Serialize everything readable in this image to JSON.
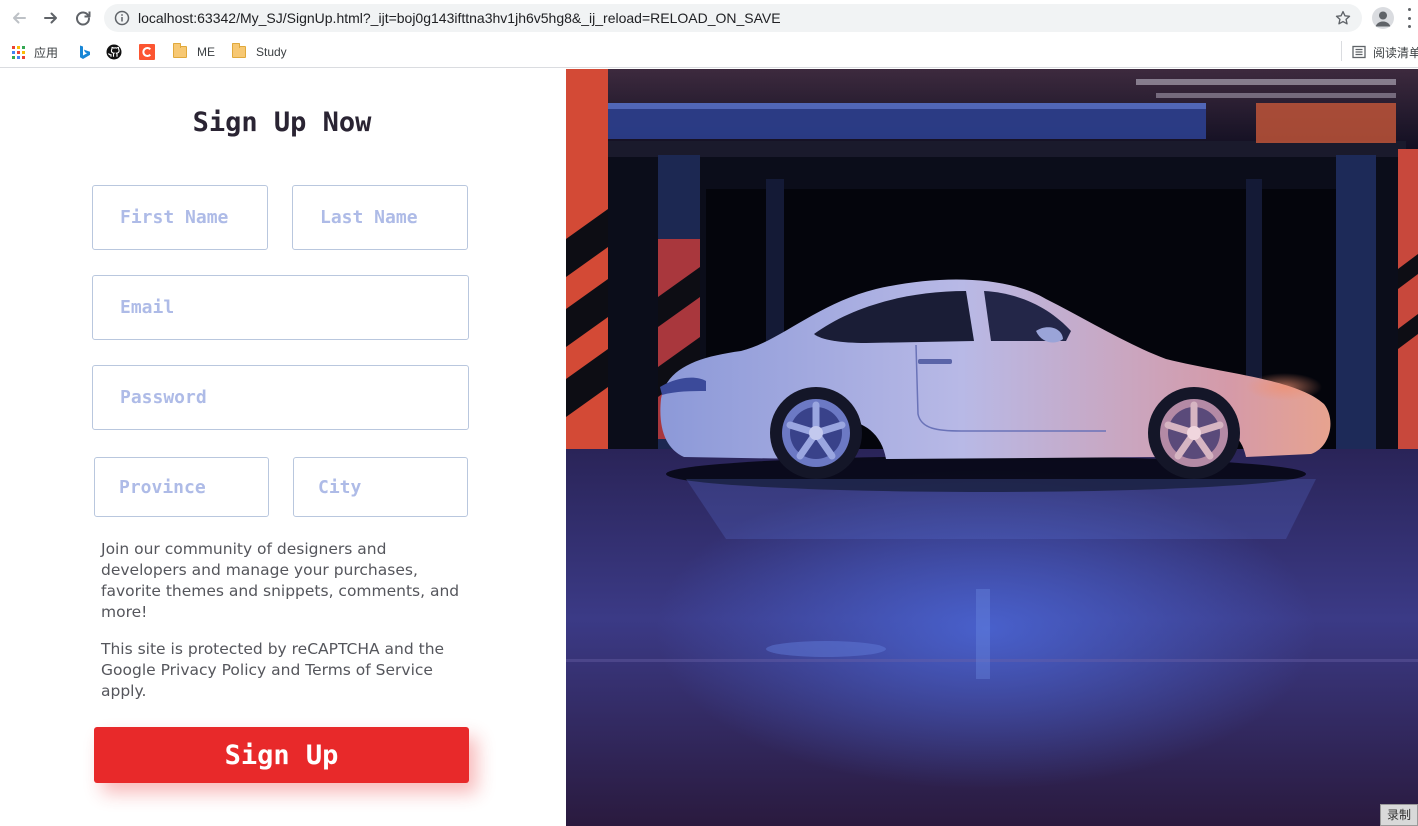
{
  "browser": {
    "url": "localhost:63342/My_SJ/SignUp.html?_ijt=boj0g143ifttna3hv1jh6v5hg8&_ij_reload=RELOAD_ON_SAVE",
    "bookmarks": [
      {
        "label": "应用",
        "icon": "apps-grid-icon"
      },
      {
        "label": "",
        "icon": "bing-icon"
      },
      {
        "label": "",
        "icon": "github-icon"
      },
      {
        "label": "",
        "icon": "csdn-icon"
      },
      {
        "label": "ME",
        "icon": "folder-icon"
      },
      {
        "label": "Study",
        "icon": "folder-icon"
      }
    ],
    "reading_list_label": "阅读清单"
  },
  "form": {
    "title": "Sign Up Now",
    "first_name_placeholder": "First Name",
    "last_name_placeholder": "Last Name",
    "email_placeholder": "Email",
    "password_placeholder": "Password",
    "province_placeholder": "Province",
    "city_placeholder": "City",
    "community_text": "Join our community of designers and developers and manage your purchases, favorite themes and snippets, comments, and more!",
    "recaptcha_text": "This site is protected by reCAPTCHA and the Google Privacy Policy and Terms of Service apply.",
    "submit_label": "Sign Up"
  },
  "colors": {
    "accent": "#e8292a",
    "field_border": "#b9c7de",
    "placeholder": "#aebbe7",
    "title": "#2a2433",
    "body_text": "#55565c"
  },
  "recording_badge": "录制"
}
